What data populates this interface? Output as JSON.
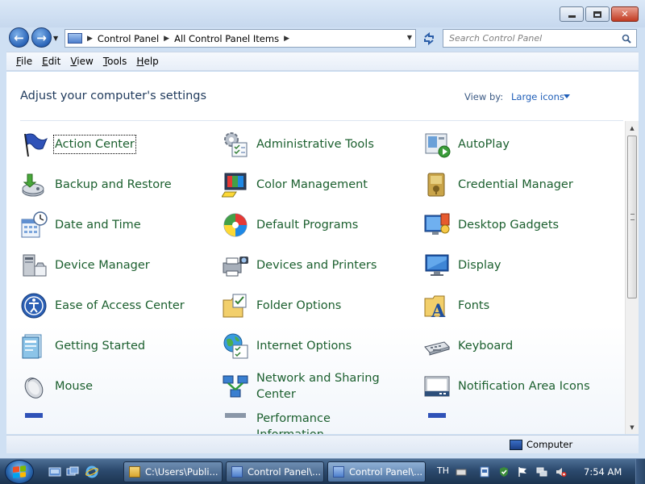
{
  "window": {
    "caption": {
      "minimize_icon": "minimize-icon",
      "maximize_icon": "maximize-icon",
      "close_icon": "close-icon",
      "close_glyph": "✕"
    }
  },
  "nav": {
    "back_glyph": "←",
    "forward_glyph": "→",
    "breadcrumbs": [
      "Control Panel",
      "All Control Panel Items"
    ],
    "search_placeholder": "Search Control Panel"
  },
  "menu": {
    "items": [
      {
        "label": "File",
        "accel": "F",
        "rest": "ile"
      },
      {
        "label": "Edit",
        "accel": "E",
        "rest": "dit"
      },
      {
        "label": "View",
        "accel": "V",
        "rest": "iew"
      },
      {
        "label": "Tools",
        "accel": "T",
        "rest": "ools"
      },
      {
        "label": "Help",
        "accel": "H",
        "rest": "elp"
      }
    ]
  },
  "content": {
    "title": "Adjust your computer's settings",
    "view_by_label": "View by:",
    "view_by_value": "Large icons",
    "items": [
      {
        "label": "Action Center",
        "icon": "action-center-flag-icon",
        "focused": true
      },
      {
        "label": "Administrative Tools",
        "icon": "administrative-tools-icon"
      },
      {
        "label": "AutoPlay",
        "icon": "autoplay-icon"
      },
      {
        "label": "Backup and Restore",
        "icon": "backup-restore-icon"
      },
      {
        "label": "Color Management",
        "icon": "color-management-icon"
      },
      {
        "label": "Credential Manager",
        "icon": "credential-manager-icon"
      },
      {
        "label": "Date and Time",
        "icon": "date-time-icon"
      },
      {
        "label": "Default Programs",
        "icon": "default-programs-icon"
      },
      {
        "label": "Desktop Gadgets",
        "icon": "desktop-gadgets-icon"
      },
      {
        "label": "Device Manager",
        "icon": "device-manager-icon"
      },
      {
        "label": "Devices and Printers",
        "icon": "devices-printers-icon"
      },
      {
        "label": "Display",
        "icon": "display-icon"
      },
      {
        "label": "Ease of Access Center",
        "icon": "ease-of-access-icon"
      },
      {
        "label": "Folder Options",
        "icon": "folder-options-icon"
      },
      {
        "label": "Fonts",
        "icon": "fonts-icon"
      },
      {
        "label": "Getting Started",
        "icon": "getting-started-icon"
      },
      {
        "label": "Internet Options",
        "icon": "internet-options-icon"
      },
      {
        "label": "Keyboard",
        "icon": "keyboard-icon"
      },
      {
        "label": "Mouse",
        "icon": "mouse-icon"
      },
      {
        "label": "Network and Sharing Center",
        "icon": "network-sharing-icon"
      },
      {
        "label": "Notification Area Icons",
        "icon": "notification-area-icon"
      },
      {
        "label": "",
        "icon": "partial-item-icon"
      },
      {
        "label": "Performance Information",
        "icon": "performance-information-icon"
      },
      {
        "label": "",
        "icon": "partial-item-icon"
      }
    ]
  },
  "status": {
    "location": "Computer"
  },
  "taskbar": {
    "buttons": [
      {
        "label": "C:\\Users\\Publi...",
        "icon": "folder-icon",
        "active": false
      },
      {
        "label": "Control Panel\\...",
        "icon": "control-panel-icon",
        "active": false
      },
      {
        "label": "Control Panel\\...",
        "icon": "control-panel-icon",
        "active": true
      }
    ],
    "language": "TH",
    "clock": "7:54 AM"
  },
  "colors": {
    "link_green": "#1b5f2e",
    "title_blue": "#1e395b",
    "accent_blue": "#1f5eb8"
  }
}
